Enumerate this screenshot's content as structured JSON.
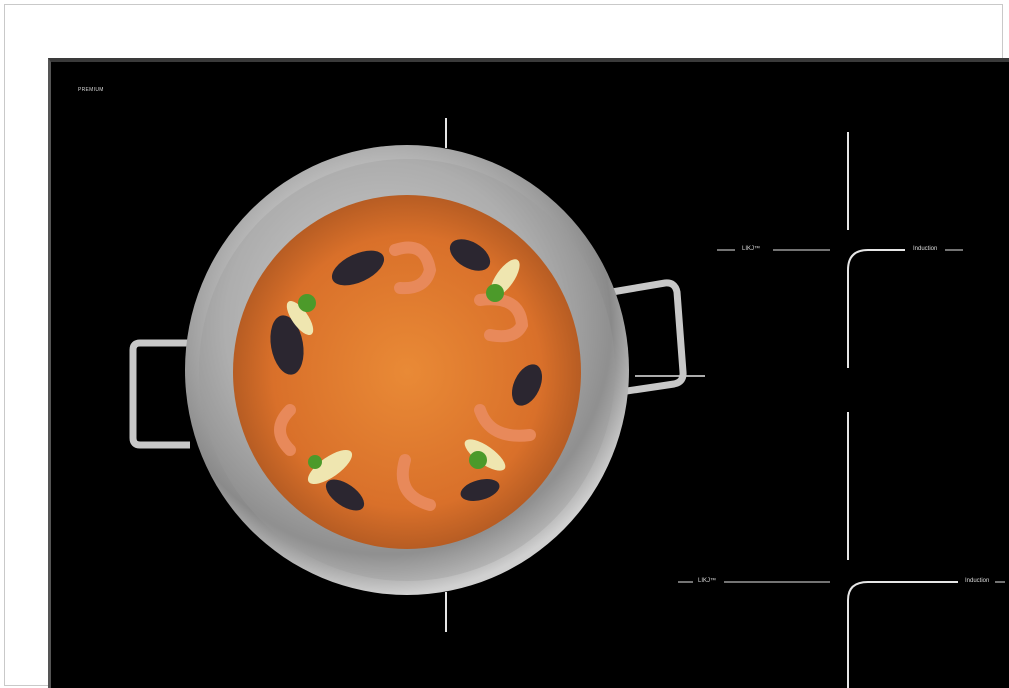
{
  "cooktop": {
    "brand": "PREMIUM",
    "labels": {
      "top_left_zone": "LIKJ™",
      "top_right_zone": "Induction",
      "bottom_left_zone": "LIKJ™",
      "bottom_right_zone": "Induction"
    }
  },
  "colors": {
    "glass": "#000000",
    "markings": "#e6e6e6",
    "pan_steel": "#bdbdbd",
    "rice": "#e07a2a"
  },
  "scene": {
    "dish": "paella in stainless steel pan with shrimp, mussels, lemon wedges and parsley"
  }
}
